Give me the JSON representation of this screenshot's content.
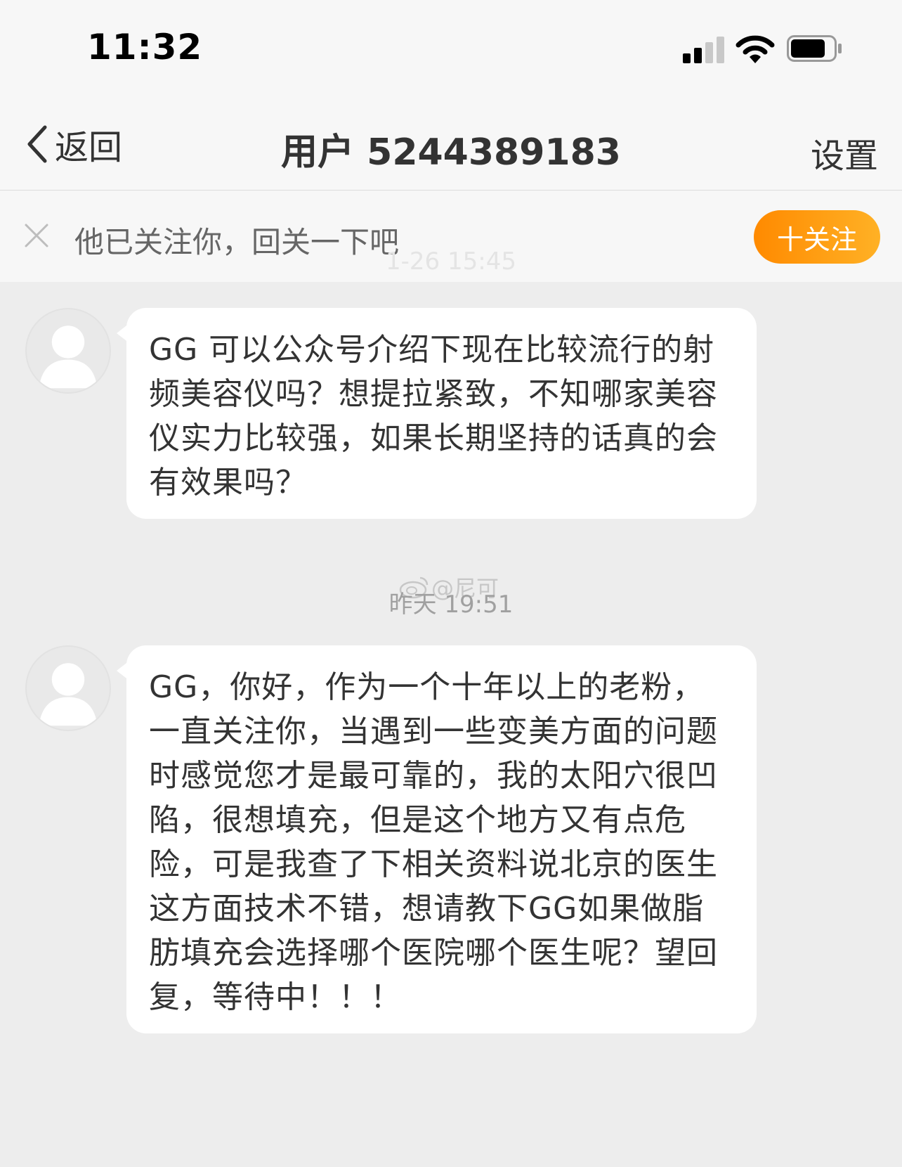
{
  "status_bar": {
    "time": "11:32"
  },
  "nav": {
    "back_label": "返回",
    "title": "用户 5244389183",
    "settings_label": "设置"
  },
  "follow_banner": {
    "text": "他已关注你，回关一下吧",
    "button_label": "十关注"
  },
  "messages": [
    {
      "timestamp": "1-26 15:45",
      "text": "GG 可以公众号介绍下现在比较流行的射频美容仪吗？想提拉紧致，不知哪家美容仪实力比较强，如果长期坚持的话真的会有效果吗？"
    },
    {
      "timestamp": "昨天 19:51",
      "text": "GG，你好，作为一个十年以上的老粉，一直关注你，当遇到一些变美方面的问题时感觉您才是最可靠的，我的太阳穴很凹陷，很想填充，但是这个地方又有点危险，可是我查了下相关资料说北京的医生这方面技术不错，想请教下GG如果做脂肪填充会选择哪个医院哪个医生呢？望回复，等待中！！！"
    }
  ],
  "watermark": "@尼可",
  "colors": {
    "accent": "#ff9a0e",
    "bubble": "#ffffff",
    "background": "#ededed"
  },
  "icons": {
    "back": "chevron-left-icon",
    "close": "close-icon",
    "signal": "cellular-signal-icon",
    "wifi": "wifi-icon",
    "battery": "battery-icon",
    "avatar": "default-avatar-icon",
    "weibo": "weibo-logo-icon"
  }
}
